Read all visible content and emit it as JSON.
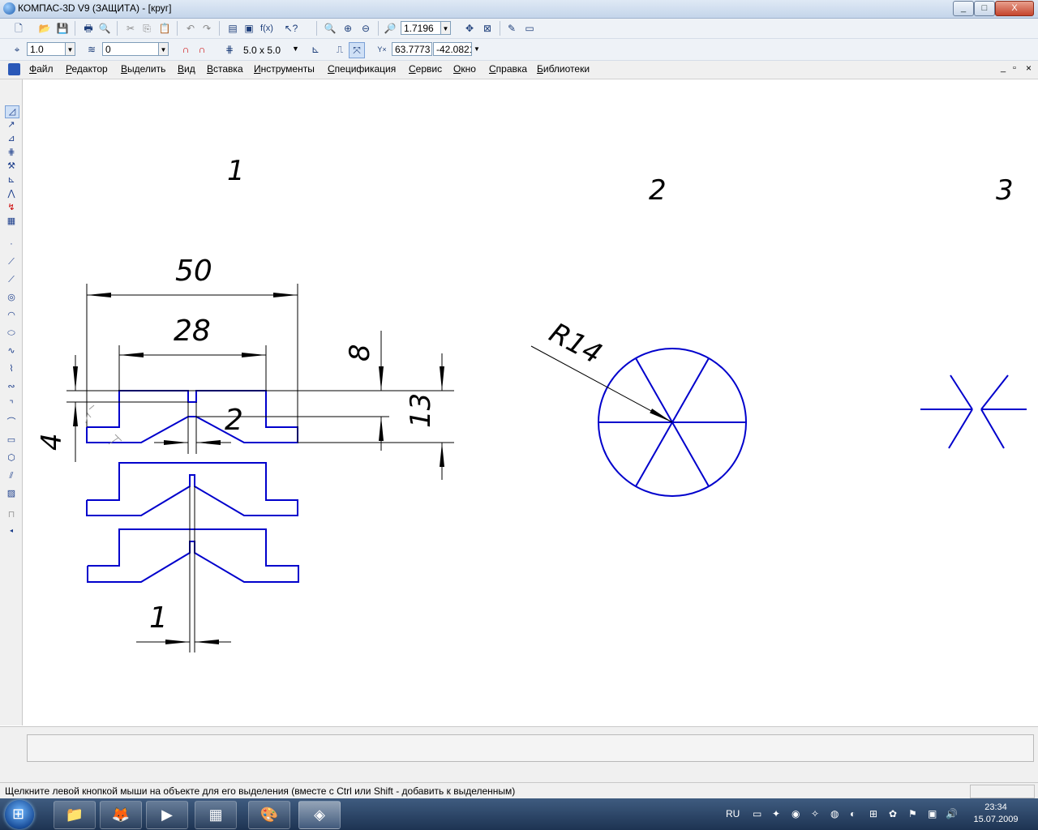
{
  "window": {
    "title": "КОМПАС-3D V9 (ЗАЩИТА) - [круг]",
    "minimize": "_",
    "maximize": "□",
    "close": "X"
  },
  "toolbar1": {
    "zoom_value": "1.7196"
  },
  "toolbar2": {
    "step_value": "1.0",
    "layer_value": "0",
    "grid_value": "5.0 x 5.0",
    "coord_x": "63.7773",
    "coord_y": "-42.0821"
  },
  "menu": {
    "items": [
      "Файл",
      "Редактор",
      "Выделить",
      "Вид",
      "Вставка",
      "Инструменты",
      "Спецификация",
      "Сервис",
      "Окно",
      "Справка",
      "Библиотеки"
    ],
    "doc_controls": [
      "_",
      "▫",
      "×"
    ]
  },
  "drawing": {
    "labels": [
      "1",
      "2",
      "3"
    ],
    "dim_50": "50",
    "dim_28": "28",
    "dim_2": "2",
    "dim_4": "4",
    "dim_8": "8",
    "dim_13": "13",
    "dim_1": "1",
    "radius": "R14",
    "line_color": "#0000cc"
  },
  "status": {
    "message": "Щелкните левой кнопкой мыши на объекте для его выделения (вместе с Ctrl или Shift - добавить к выделенным)"
  },
  "taskbar": {
    "language": "RU",
    "time": "23:34",
    "date": "15.07.2009"
  }
}
